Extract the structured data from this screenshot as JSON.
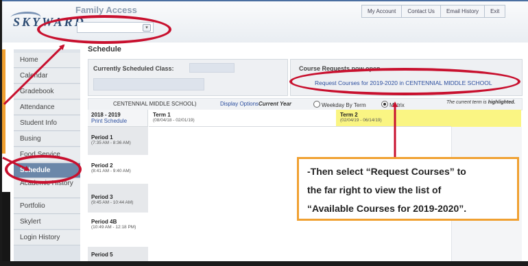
{
  "header": {
    "app_title": "Family Access",
    "logo_text": "SKYWARD",
    "entity_select_value": "",
    "top_links": [
      "My Account",
      "Contact Us",
      "Email History",
      "Exit"
    ]
  },
  "sidebar": {
    "items": [
      {
        "label": "Home"
      },
      {
        "label": "Calendar"
      },
      {
        "label": "Gradebook"
      },
      {
        "label": "Attendance"
      },
      {
        "label": "Student Info"
      },
      {
        "label": "Busing"
      },
      {
        "label": "Food Service"
      },
      {
        "label": "Schedule"
      },
      {
        "label": "Academic History"
      },
      {
        "label": "Portfolio"
      },
      {
        "label": "Skylert"
      },
      {
        "label": "Login History"
      }
    ],
    "active": "Schedule"
  },
  "main": {
    "title": "Schedule",
    "current_class_label": "Currently Scheduled Class:",
    "course_requests_label": "Course Requests now open",
    "request_link": "Request Courses for 2019-2020 in CENTENNIAL MIDDLE SCHOOL",
    "options": {
      "school_text": "CENTENNIAL MIDDLE SCHOOL)",
      "display_options": "Display Options",
      "current_year": "Current Year",
      "weekday_by_term": "Weekday By Term",
      "matrix": "Matrix",
      "legend_prefix": "The current term is ",
      "legend_emph": "highlighted."
    },
    "grid": {
      "year": "2018 - 2019",
      "print_schedule": "Print Schedule",
      "terms": [
        {
          "name": "Term 1",
          "dates": "(08/04/18 - 02/01/19)"
        },
        {
          "name": "Term 2",
          "dates": "(02/04/19 - 06/14/19)"
        }
      ],
      "periods": [
        {
          "name": "Period 1",
          "time": "(7:35 AM - 8:36 AM)"
        },
        {
          "name": "Period 2",
          "time": "(8:41 AM - 9:40 AM)"
        },
        {
          "name": "Period 3",
          "time": "(9:45 AM - 10:44 AM)"
        },
        {
          "name": "Period 4B",
          "time": "(10:49 AM - 12:18 PM)"
        },
        {
          "name": "Period 5",
          "time": ""
        }
      ]
    }
  },
  "callout": {
    "lines": [
      "-Then select “Request Courses” to",
      "the far right to view the list of",
      "“Available Courses for 2019-2020”."
    ]
  },
  "colors": {
    "annotation_red": "#c8102e",
    "callout_border": "#f0a030",
    "highlight_term": "#faf583",
    "active_nav": "#6b87a9"
  }
}
